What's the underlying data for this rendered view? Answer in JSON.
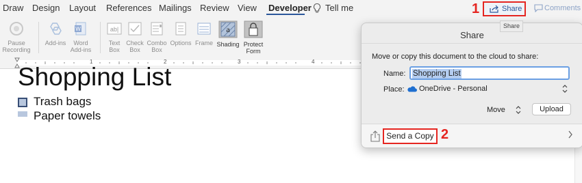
{
  "tabs": [
    "Draw",
    "Design",
    "Layout",
    "References",
    "Mailings",
    "Review",
    "View",
    "Developer",
    "Tell me"
  ],
  "active_tab": "Developer",
  "share_button": {
    "label": "Share"
  },
  "comments_button": {
    "label": "Comments"
  },
  "tooltip": "Share",
  "callouts": {
    "one": "1",
    "two": "2"
  },
  "ribbon": {
    "pause_recording": [
      "Pause",
      "Recording"
    ],
    "add_ins": [
      "Add-ins"
    ],
    "word_add_ins": [
      "Word",
      "Add-ins"
    ],
    "text_box": [
      "Text",
      "Box"
    ],
    "check_box": [
      "Check",
      "Box"
    ],
    "combo_box": [
      "Combo",
      "Box"
    ],
    "options": [
      "Options"
    ],
    "frame": [
      "Frame"
    ],
    "shading": [
      "Shading"
    ],
    "protect_form": [
      "Protect",
      "Form"
    ]
  },
  "ruler": {
    "numbers": [
      "1",
      "2",
      "3",
      "4",
      "5"
    ]
  },
  "document": {
    "title": "Shopping List",
    "items": [
      "Trash bags",
      "Paper towels"
    ]
  },
  "share_panel": {
    "title": "Share",
    "description": "Move or copy this document to the cloud to share:",
    "name_label": "Name:",
    "name_value": "Shopping List",
    "place_label": "Place:",
    "place_value": "OneDrive - Personal",
    "move_label": "Move",
    "upload_label": "Upload",
    "send_copy_label": "Send a Copy"
  },
  "colors": {
    "accent": "#2b579a",
    "callout": "#e52520",
    "onedrive": "#1f6fd0"
  }
}
